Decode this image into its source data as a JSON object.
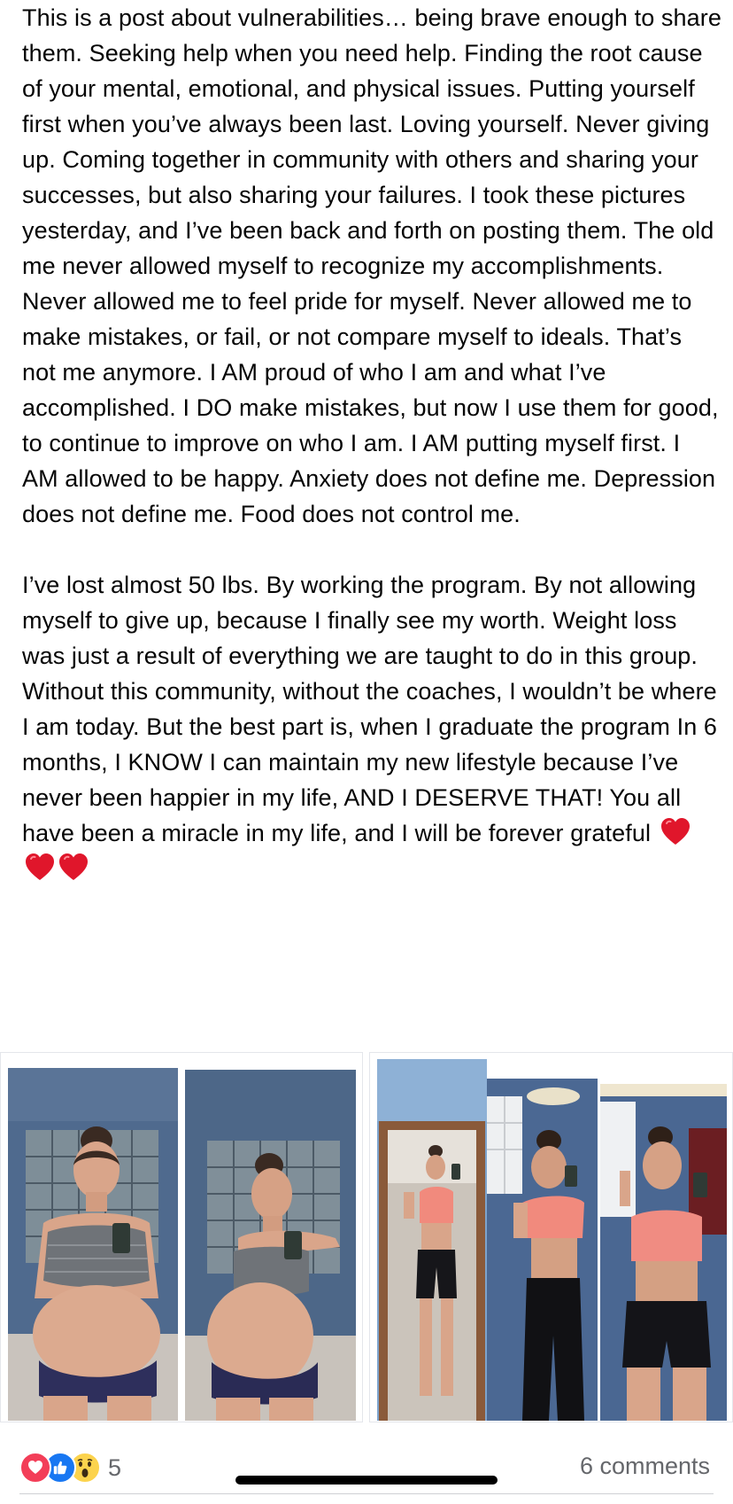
{
  "post": {
    "paragraph1": "This is a post about vulnerabilities… being brave enough to share them. Seeking help when you need help. Finding the root cause of your mental, emotional, and physical issues. Putting yourself first when you’ve always been last. Loving yourself. Never giving up. Coming together in community with others and sharing your successes, but also sharing your failures. I took these pictures yesterday, and I’ve been back and forth on posting them. The old me never allowed myself to recognize my accomplishments. Never allowed me to feel pride for myself. Never allowed me to make mistakes, or fail, or not compare myself to ideals. That’s not me anymore. I AM proud of who I am and what I’ve accomplished. I DO make mistakes, but now I use them for good, to continue to improve on who I am. I AM putting myself first. I AM allowed to be happy. Anxiety does not define me. Depression does not define me. Food does not control me.",
    "paragraph2": "I’ve lost almost 50 lbs. By working the program. By not allowing myself to give up, because I finally see my worth. Weight loss was just a result of everything we are taught to do in this group. Without this community, without the coaches, I wouldn’t be where I am today. But the best part is, when I graduate the program In 6 months, I KNOW I can maintain my new lifestyle because I’ve never been happier in my life, AND I DESERVE THAT! You all have been a miracle in my life, and I will be forever grateful",
    "trailing_emoji": [
      "red-heart-icon",
      "red-heart-icon",
      "red-heart-icon"
    ]
  },
  "photos": {
    "left_group": [
      "before-photo-front",
      "before-photo-side"
    ],
    "right_group": [
      "after-photo-mirror-full",
      "after-photo-side",
      "after-photo-front"
    ]
  },
  "footer": {
    "reaction_icons": [
      "love-reaction-icon",
      "like-reaction-icon",
      "wow-reaction-icon"
    ],
    "reaction_count": "5",
    "comments_label": "6 comments"
  },
  "colors": {
    "text": "#050505",
    "secondary_text": "#65676b",
    "love": "#f33e58",
    "like": "#1877f2",
    "wow": "#fcd34d",
    "heart": "#e0162b"
  }
}
